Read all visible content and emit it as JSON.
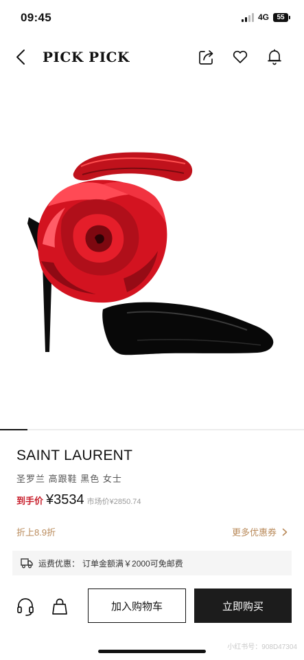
{
  "status_bar": {
    "time": "09:45",
    "network": "4G",
    "battery": "55"
  },
  "nav": {
    "title": "PICK PICK",
    "icons": [
      "back-icon",
      "share-icon",
      "heart-icon",
      "bell-icon"
    ]
  },
  "product": {
    "image_icon": "red-rose-high-heel-shoe",
    "image_count_indicator": "1",
    "brand": "SAINT LAURENT",
    "name": "圣罗兰 高跟鞋 黑色 女士",
    "price_label": "到手价",
    "price": "¥3534",
    "market_price": "市场价¥2850.74"
  },
  "promo": {
    "discount": "折上8.9折",
    "coupon_link": "更多优惠券"
  },
  "shipping": {
    "label": "运费优惠：",
    "text": "订单金额满￥2000可免邮费"
  },
  "actions": {
    "service_icon": "headset-icon",
    "bag_icon": "shopping-bag-icon",
    "add_to_cart": "加入购物车",
    "buy_now": "立即购买"
  },
  "watermark": "小红书号：908D47304",
  "colors": {
    "price_label": "#c81f2c",
    "promo": "#b98a5a",
    "buy_button": "#1c1c1c"
  }
}
